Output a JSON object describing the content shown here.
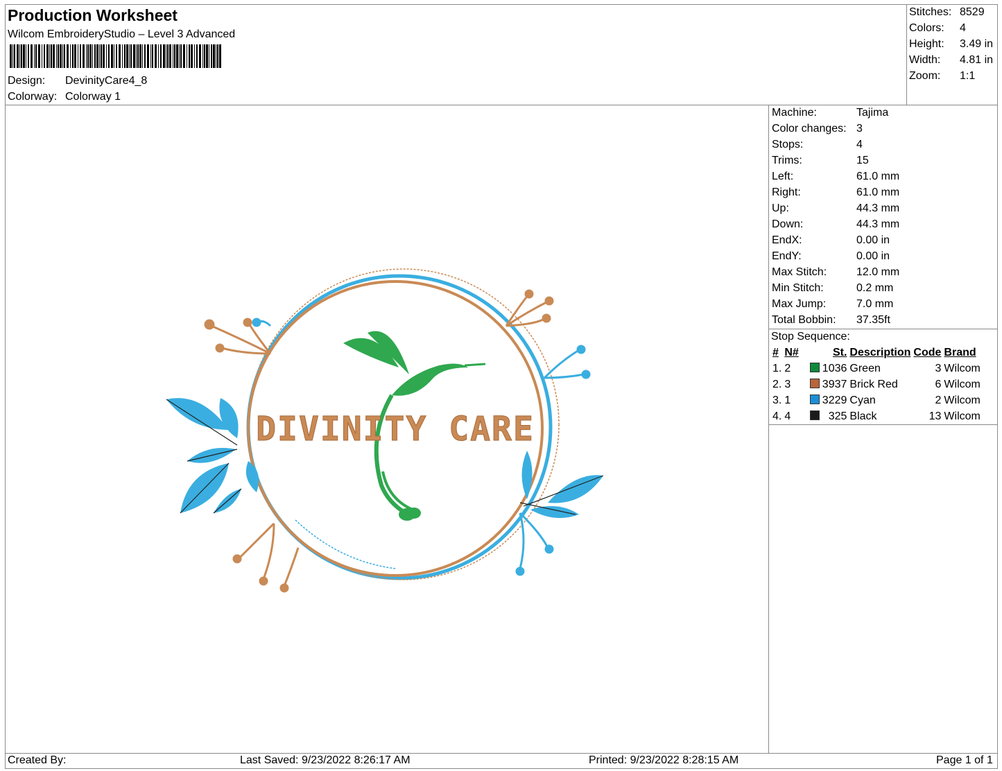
{
  "header": {
    "title": "Production Worksheet",
    "subtitle": "Wilcom EmbroideryStudio – Level 3 Advanced",
    "design_label": "Design:",
    "design_value": "DevinityCare4_8",
    "colorway_label": "Colorway:",
    "colorway_value": "Colorway 1"
  },
  "summary": {
    "stitches_label": "Stitches:",
    "stitches_value": "8529",
    "colors_label": "Colors:",
    "colors_value": "4",
    "height_label": "Height:",
    "height_value": "3.49 in",
    "width_label": "Width:",
    "width_value": "4.81 in",
    "zoom_label": "Zoom:",
    "zoom_value": "1:1"
  },
  "machine": [
    {
      "label": "Machine:",
      "value": "Tajima"
    },
    {
      "label": "Color changes:",
      "value": "3"
    },
    {
      "label": "Stops:",
      "value": "4"
    },
    {
      "label": "Trims:",
      "value": "15"
    },
    {
      "label": "Left:",
      "value": "61.0 mm"
    },
    {
      "label": "Right:",
      "value": "61.0 mm"
    },
    {
      "label": "Up:",
      "value": "44.3 mm"
    },
    {
      "label": "Down:",
      "value": "44.3 mm"
    },
    {
      "label": "EndX:",
      "value": "0.00 in"
    },
    {
      "label": "EndY:",
      "value": "0.00 in"
    },
    {
      "label": "Max Stitch:",
      "value": "12.0 mm"
    },
    {
      "label": "Min Stitch:",
      "value": "0.2 mm"
    },
    {
      "label": "Max Jump:",
      "value": "7.0 mm"
    },
    {
      "label": "Total Bobbin:",
      "value": "37.35ft"
    }
  ],
  "stop_sequence": {
    "title": "Stop Sequence:",
    "headers": [
      "#",
      "N#",
      "St.",
      "Description",
      "Code",
      "Brand"
    ],
    "rows": [
      {
        "num": "1.",
        "n": "2",
        "color": "#0c8a3c",
        "st": "1036",
        "desc": "Green",
        "code": "3",
        "brand": "Wilcom"
      },
      {
        "num": "2.",
        "n": "3",
        "color": "#b8653a",
        "st": "3937",
        "desc": "Brick Red",
        "code": "6",
        "brand": "Wilcom"
      },
      {
        "num": "3.",
        "n": "1",
        "color": "#1b8fd6",
        "st": "3229",
        "desc": "Cyan",
        "code": "2",
        "brand": "Wilcom"
      },
      {
        "num": "4.",
        "n": "4",
        "color": "#1a1a1a",
        "st": "325",
        "desc": "Black",
        "code": "13",
        "brand": "Wilcom"
      }
    ]
  },
  "design": {
    "text": "DIVINITY CARE",
    "colors": {
      "green": "#2fa84f",
      "brown": "#c98a55",
      "cyan": "#3aaee0",
      "black": "#222222"
    }
  },
  "footer": {
    "created_by": "Created By:",
    "last_saved": "Last Saved: 9/23/2022 8:26:17 AM",
    "printed": "Printed: 9/23/2022 8:28:15 AM",
    "page": "Page 1 of 1"
  }
}
